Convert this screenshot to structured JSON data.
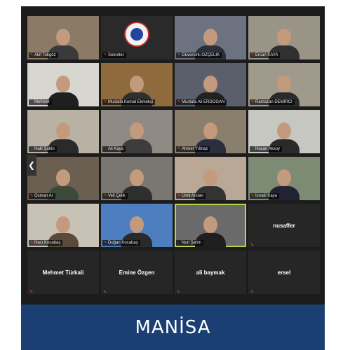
{
  "banner": {
    "title": "MANİSA"
  },
  "colors": {
    "active_outline": "#b5d54a",
    "banner": "#1b3f73",
    "muted_mic": "#e2423b"
  },
  "nav": {
    "prev_icon": "chevron-left-icon",
    "prev_glyph": "❮"
  },
  "participants": [
    {
      "name": "Akif Tokgöz",
      "bg": "#8a7a66",
      "shirt": "#3a3a3a",
      "muted": true
    },
    {
      "name": "Sekreter",
      "bg": "#2a2a2a",
      "logo": true,
      "muted": true
    },
    {
      "name": "Güvercinli ÖZÇELİK",
      "bg": "#6d7280",
      "shirt": "#2b2f3a",
      "muted": true
    },
    {
      "name": "Ercan KAYA",
      "bg": "#9a9487",
      "shirt": "#303030",
      "muted": true
    },
    {
      "name": "Mehmet",
      "bg": "#d8d6d0",
      "shirt": "#1f1f1f",
      "muted": false
    },
    {
      "name": "Mustafa Kemal Ekmekçi",
      "bg": "#8e6a3c",
      "shirt": "#2f2f2f",
      "muted": true
    },
    {
      "name": "Mustafa Ali ERDOĞAN",
      "bg": "#5a5f6b",
      "shirt": "#222",
      "muted": true
    },
    {
      "name": "Ramazan DEMİRCİ",
      "bg": "#a09a8c",
      "shirt": "#2a2a2a",
      "muted": true
    },
    {
      "name": "Halil Şahin",
      "bg": "#b9b2a4",
      "shirt": "#2a2a2a",
      "muted": false
    },
    {
      "name": "Ali Kaya",
      "bg": "#8f8a83",
      "shirt": "#3c3c3c",
      "muted": false
    },
    {
      "name": "Ahmet Yılmaz",
      "bg": "#8a7e6d",
      "shirt": "#2d2d40",
      "muted": true
    },
    {
      "name": "Hasan Aksoy",
      "bg": "#c7c7c2",
      "shirt": "#2a2a2a",
      "muted": false
    },
    {
      "name": "Osman Ar",
      "bg": "#6b5f52",
      "shirt": "#3b4a3b",
      "muted": true
    },
    {
      "name": "Veli Çelik",
      "bg": "#7a7670",
      "shirt": "#2f2f2f",
      "muted": true
    },
    {
      "name": "Ümit Arslan",
      "bg": "#b8a895",
      "shirt": "#333",
      "muted": true
    },
    {
      "name": "İsmail Kaya",
      "bg": "#7d8b74",
      "shirt": "#223",
      "muted": true
    },
    {
      "name": "Hacı Kocabaş",
      "bg": "#c8c2b6",
      "shirt": "#5a4a3a",
      "muted": true
    },
    {
      "name": "Doğan Kocabaş",
      "bg": "#4d7fc0",
      "shirt": "#2a2a2a",
      "muted": true
    },
    {
      "name": "Nuri Şahin",
      "bg": "#6a6a6a",
      "shirt": "#1f1f1f",
      "muted": false,
      "active": true
    },
    {
      "name": "nusaffer",
      "bg": "#262626",
      "text_only": true,
      "muted": true
    },
    {
      "name": "Mehmet Türkali",
      "bg": "#262626",
      "text_only": true,
      "muted": true
    },
    {
      "name": "Emine Özgen",
      "bg": "#262626",
      "text_only": true,
      "muted": true
    },
    {
      "name": "ali baymak",
      "bg": "#262626",
      "text_only": true,
      "muted": true
    },
    {
      "name": "ersel",
      "bg": "#262626",
      "text_only": true,
      "muted": true
    }
  ]
}
